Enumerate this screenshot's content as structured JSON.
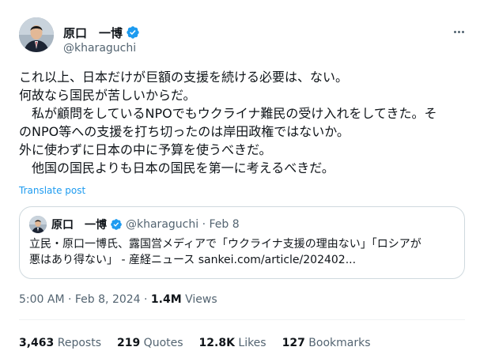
{
  "author": {
    "display_name": "原口　一博",
    "handle": "@kharaguchi",
    "verified": true
  },
  "tweet": {
    "lines": [
      "これ以上、日本だけが巨額の支援を続ける必要は、ない。",
      "何故なら国民が苦しいからだ。",
      "　私が顧問をしているNPOでもウクライナ難民の受け入れをしてきた。そ",
      "のNPO等への支援を打ち切ったのは岸田政権ではないか。",
      "外に使わずに日本の中に予算を使うべきだ。",
      "　他国の国民よりも日本の国民を第一に考えるべきだ。"
    ],
    "translate_label": "Translate post"
  },
  "quote": {
    "display_name": "原口　一博",
    "handle_date": "@kharaguchi · Feb 8",
    "lines": [
      "立民・原口一博氏、露国営メディアで「ウクライナ支援の理由ない」「ロシアが",
      "悪はあり得ない」 - 産経ニュース sankei.com/article/202402..."
    ]
  },
  "meta": {
    "timestamp": "5:00 AM · Feb 8, 2024 · ",
    "views_count": "1.4M",
    "views_label": " Views"
  },
  "stats": {
    "reposts_count": "3,463",
    "reposts_label": " Reposts",
    "quotes_count": "219",
    "quotes_label": " Quotes",
    "likes_count": "12.8K",
    "likes_label": " Likes",
    "bookmarks_count": "127",
    "bookmarks_label": " Bookmarks"
  },
  "colors": {
    "text": "#0f1419",
    "secondary": "#536471",
    "accent": "#1d9bf0",
    "border": "#cfd9de"
  },
  "icons": {
    "verified": "verified-badge-icon",
    "more": "more-options-icon"
  }
}
